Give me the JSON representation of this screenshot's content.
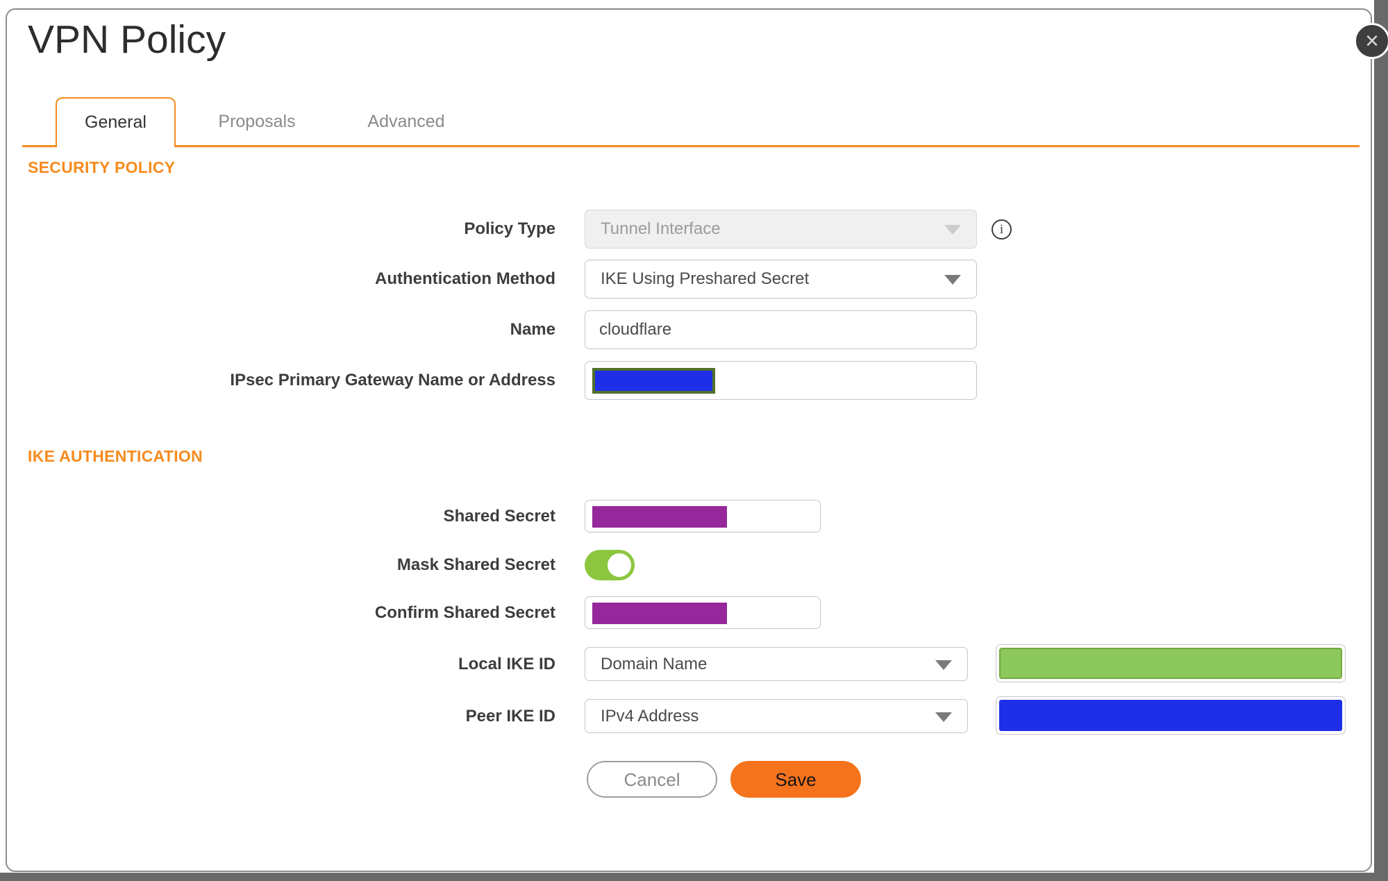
{
  "window": {
    "title": "VPN Policy"
  },
  "icons": {
    "close": "×",
    "info": "i"
  },
  "tabs": {
    "general": "General",
    "proposals": "Proposals",
    "advanced": "Advanced",
    "active_tab": "General"
  },
  "security_policy": {
    "heading": "SECURITY POLICY",
    "policy_type": {
      "label": "Policy Type",
      "value": "Tunnel Interface",
      "disabled": true
    },
    "authentication_method": {
      "label": "Authentication Method",
      "value": "IKE Using Preshared Secret"
    },
    "name": {
      "label": "Name",
      "value": "cloudflare"
    },
    "gateway": {
      "label": "IPsec Primary Gateway Name or Address",
      "redacted": true
    }
  },
  "ike_authentication": {
    "heading": "IKE AUTHENTICATION",
    "shared_secret": {
      "label": "Shared Secret",
      "redacted": true
    },
    "mask_shared_secret": {
      "label": "Mask Shared Secret",
      "toggle_on": true
    },
    "confirm_shared_secret": {
      "label": "Confirm Shared Secret",
      "redacted": true
    },
    "local_ike_id": {
      "label": "Local IKE ID",
      "type": "Domain Name",
      "redacted": true
    },
    "peer_ike_id": {
      "label": "Peer IKE ID",
      "type": "IPv4 Address",
      "redacted": true
    }
  },
  "buttons": {
    "cancel": "Cancel",
    "save": "Save"
  },
  "colors": {
    "accent_orange": "#F68B1E",
    "save_button_orange": "#F4731C",
    "toggle_green": "#8CC63F",
    "redaction_purple": "#97289B",
    "redaction_blue": "#1F2FE8",
    "redaction_green_fill": "#8CC85C",
    "redaction_green_border": "#74A83C",
    "redaction_olive_border": "#50702A",
    "backdrop_gray": "#696969"
  }
}
